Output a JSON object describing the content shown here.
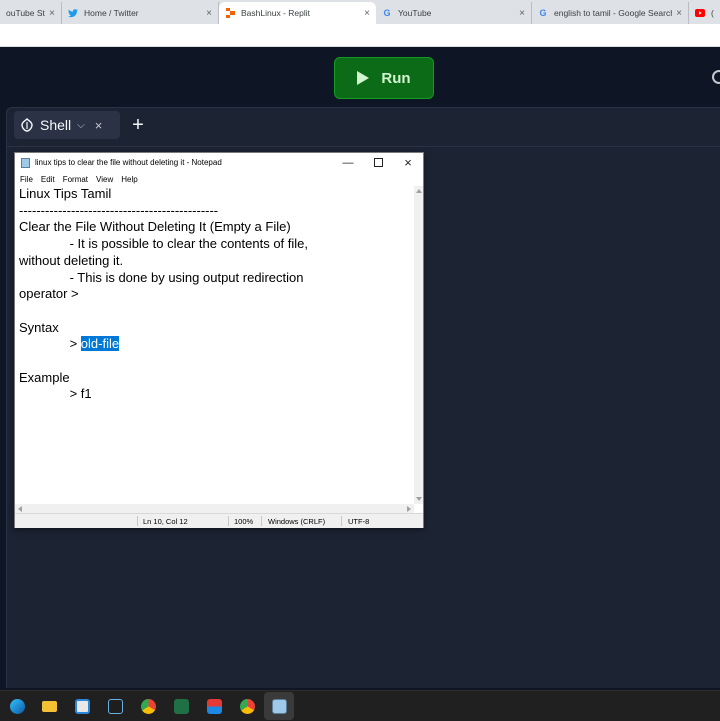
{
  "browser": {
    "tabs": [
      {
        "title": "ouTube Stu",
        "active": false
      },
      {
        "title": "Home / Twitter",
        "active": false
      },
      {
        "title": "BashLinux - Replit",
        "active": true
      },
      {
        "title": "YouTube",
        "active": false
      },
      {
        "title": "english to tamil - Google Search",
        "active": false
      },
      {
        "title": "(",
        "active": false
      }
    ],
    "close_glyph": "×"
  },
  "replit": {
    "run_label": "Run",
    "shell_tab_label": "Shell",
    "add_tab_glyph": "+",
    "close_glyph": "×",
    "run_color": "#0b6b16"
  },
  "notepad": {
    "window_title": "linux tips to clear the file without deleting it - Notepad",
    "menu": {
      "file": "File",
      "edit": "Edit",
      "format": "Format",
      "view": "View",
      "help": "Help"
    },
    "content": {
      "line1": "Linux Tips Tamil",
      "line2": "----------------------------------------------",
      "line3": "Clear the File Without Deleting It (Empty a File)",
      "line4": "              - It is possible to clear the contents of file,",
      "line5": "without deleting it.",
      "line6": "              - This is done by using output redirection",
      "line7": "operator >",
      "line8": "",
      "line9": "Syntax",
      "line10_prefix": "              > ",
      "line10_selected": "old-file",
      "line11": "",
      "line12": "Example",
      "line13": "              > f1"
    },
    "status": {
      "position": "Ln 10, Col 12",
      "zoom": "100%",
      "line_ending": "Windows (CRLF)",
      "encoding": "UTF-8"
    },
    "selection_color": "#0078d7"
  },
  "taskbar": {
    "icons": [
      "edge-icon",
      "file-explorer-icon",
      "store-icon",
      "terminal-icon",
      "chrome-icon",
      "excel-icon",
      "app-icon",
      "chrome-profile-icon",
      "notepad-icon"
    ]
  }
}
